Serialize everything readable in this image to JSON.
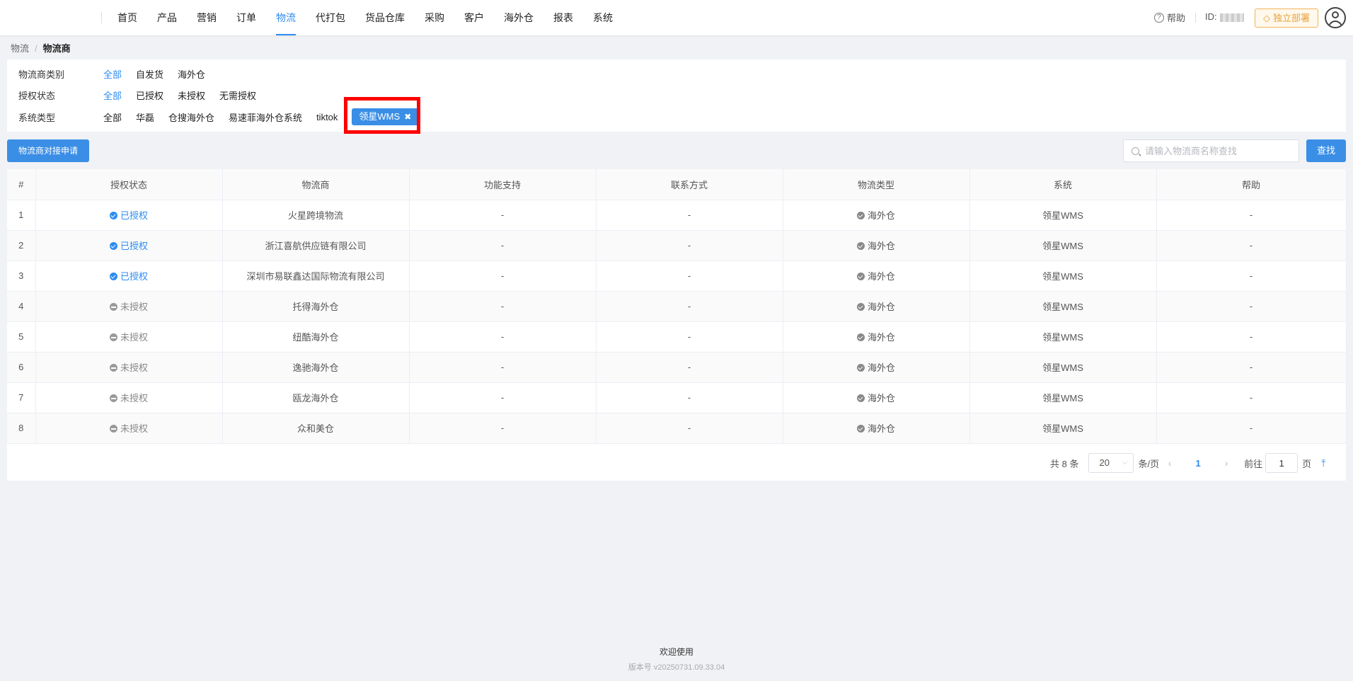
{
  "nav": {
    "items": [
      "首页",
      "产品",
      "营销",
      "订单",
      "物流",
      "代打包",
      "货品仓库",
      "采购",
      "客户",
      "海外仓",
      "报表",
      "系统"
    ],
    "active_index": 4,
    "help_label": "帮助",
    "id_label": "ID:",
    "deploy_label": "独立部署",
    "accent": "#2d8cf0"
  },
  "breadcrumb": {
    "parent": "物流",
    "separator": "/",
    "current": "物流商"
  },
  "filters": {
    "category": {
      "label": "物流商类别",
      "options": [
        "全部",
        "自发货",
        "海外仓"
      ]
    },
    "auth": {
      "label": "授权状态",
      "options": [
        "全部",
        "已授权",
        "未授权",
        "无需授权"
      ]
    },
    "system": {
      "label": "系统类型",
      "options": [
        "全部",
        "华磊",
        "仓搜海外仓",
        "易速菲海外仓系统",
        "tiktok"
      ],
      "selected_chip": "领星WMS",
      "chip_close": "✖"
    }
  },
  "toolbar": {
    "apply_label": "物流商对接申请",
    "search_placeholder": "请输入物流商名称查找",
    "search_label": "查找"
  },
  "table": {
    "headers": [
      "#",
      "授权状态",
      "物流商",
      "功能支持",
      "联系方式",
      "物流类型",
      "系统",
      "帮助"
    ],
    "rows": [
      {
        "idx": "1",
        "status": "已授权",
        "authorized": true,
        "name": "火星跨境物流",
        "func": "-",
        "contact": "-",
        "type": "海外仓",
        "system": "领星WMS",
        "help": "-"
      },
      {
        "idx": "2",
        "status": "已授权",
        "authorized": true,
        "name": "浙江喜航供应链有限公司",
        "func": "-",
        "contact": "-",
        "type": "海外仓",
        "system": "领星WMS",
        "help": "-"
      },
      {
        "idx": "3",
        "status": "已授权",
        "authorized": true,
        "name": "深圳市易联鑫达国际物流有限公司",
        "func": "-",
        "contact": "-",
        "type": "海外仓",
        "system": "领星WMS",
        "help": "-"
      },
      {
        "idx": "4",
        "status": "未授权",
        "authorized": false,
        "name": "托得海外仓",
        "func": "-",
        "contact": "-",
        "type": "海外仓",
        "system": "领星WMS",
        "help": "-"
      },
      {
        "idx": "5",
        "status": "未授权",
        "authorized": false,
        "name": "纽酷海外仓",
        "func": "-",
        "contact": "-",
        "type": "海外仓",
        "system": "领星WMS",
        "help": "-"
      },
      {
        "idx": "6",
        "status": "未授权",
        "authorized": false,
        "name": "逸驰海外仓",
        "func": "-",
        "contact": "-",
        "type": "海外仓",
        "system": "领星WMS",
        "help": "-"
      },
      {
        "idx": "7",
        "status": "未授权",
        "authorized": false,
        "name": "瓯龙海外仓",
        "func": "-",
        "contact": "-",
        "type": "海外仓",
        "system": "领星WMS",
        "help": "-"
      },
      {
        "idx": "8",
        "status": "未授权",
        "authorized": false,
        "name": "众和美仓",
        "func": "-",
        "contact": "-",
        "type": "海外仓",
        "system": "领星WMS",
        "help": "-"
      }
    ]
  },
  "pager": {
    "total": "共 8 条",
    "page_size": "20",
    "per_page": "条/页",
    "prev": "‹",
    "current": "1",
    "next": "›",
    "goto_label": "前往",
    "goto_value": "1",
    "page_label": "页",
    "top": "⤒"
  },
  "footer": {
    "welcome": "欢迎使用",
    "version": "版本号 v20250731.09.33.04"
  }
}
